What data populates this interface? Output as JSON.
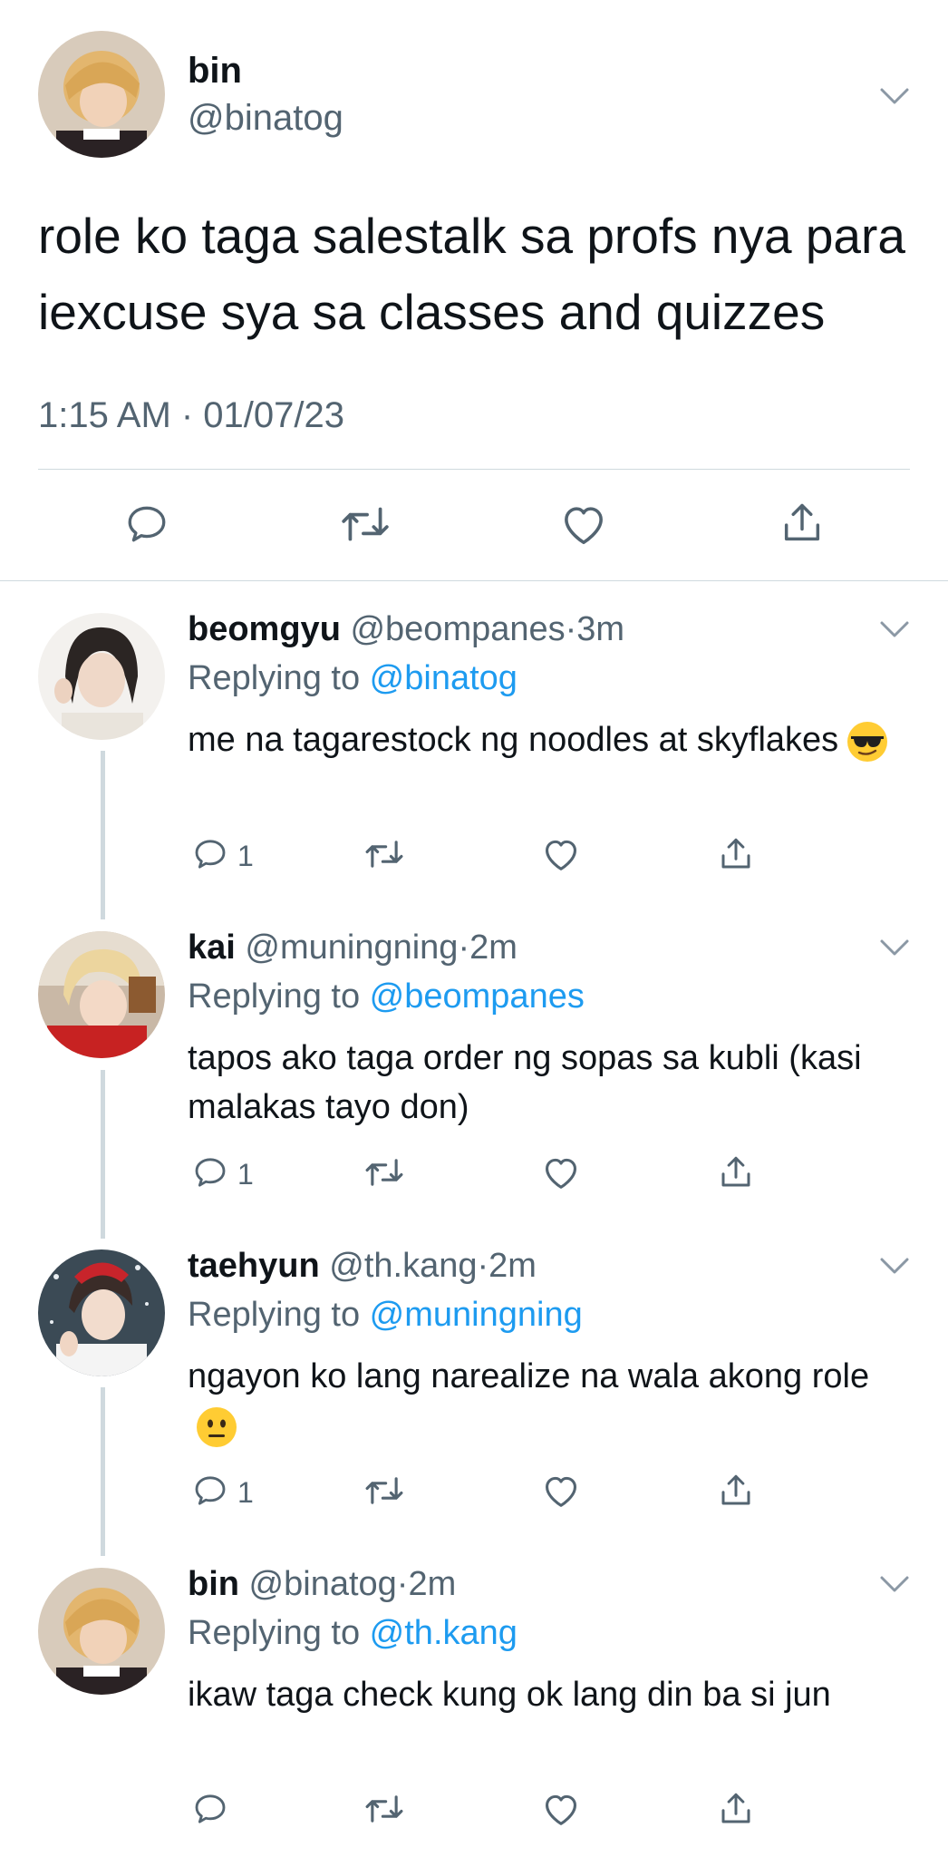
{
  "main_tweet": {
    "name": "bin",
    "handle": "@binatog",
    "text": "role ko taga salestalk sa profs nya para iexcuse sya sa classes and quizzes",
    "timestamp": "1:15 AM · 01/07/23"
  },
  "icons": {
    "reply": "reply-icon",
    "retweet": "retweet-icon",
    "like": "heart-icon",
    "share": "share-icon",
    "more": "chevron-down-icon"
  },
  "colors": {
    "link": "#1d9bf0",
    "secondary_text": "#536471",
    "divider": "#cfd9de"
  },
  "replies": [
    {
      "name": "beomgyu",
      "handle": "@beompanes",
      "separator": "·",
      "time": "3m",
      "replying_prefix": "Replying to ",
      "replying_to": "@binatog",
      "text": "me na tagarestock ng noodles at skyflakes",
      "emoji": "smiling-face-with-sunglasses",
      "reply_count": "1"
    },
    {
      "name": "kai",
      "handle": "@muningning",
      "separator": "·",
      "time": "2m",
      "replying_prefix": "Replying to ",
      "replying_to": "@beompanes",
      "text": "tapos ako taga order ng sopas sa kubli (kasi malakas tayo don)",
      "emoji": "",
      "reply_count": "1"
    },
    {
      "name": "taehyun",
      "handle": "@th.kang",
      "separator": "·",
      "time": "2m",
      "replying_prefix": "Replying to ",
      "replying_to": "@muningning",
      "text": "ngayon ko lang narealize na wala akong role",
      "emoji": "neutral-face",
      "reply_count": "1"
    },
    {
      "name": "bin",
      "handle": "@binatog",
      "separator": "·",
      "time": "2m",
      "replying_prefix": "Replying to ",
      "replying_to": "@th.kang",
      "text": "ikaw taga check kung ok lang din ba si jun",
      "emoji": "",
      "reply_count": ""
    }
  ]
}
